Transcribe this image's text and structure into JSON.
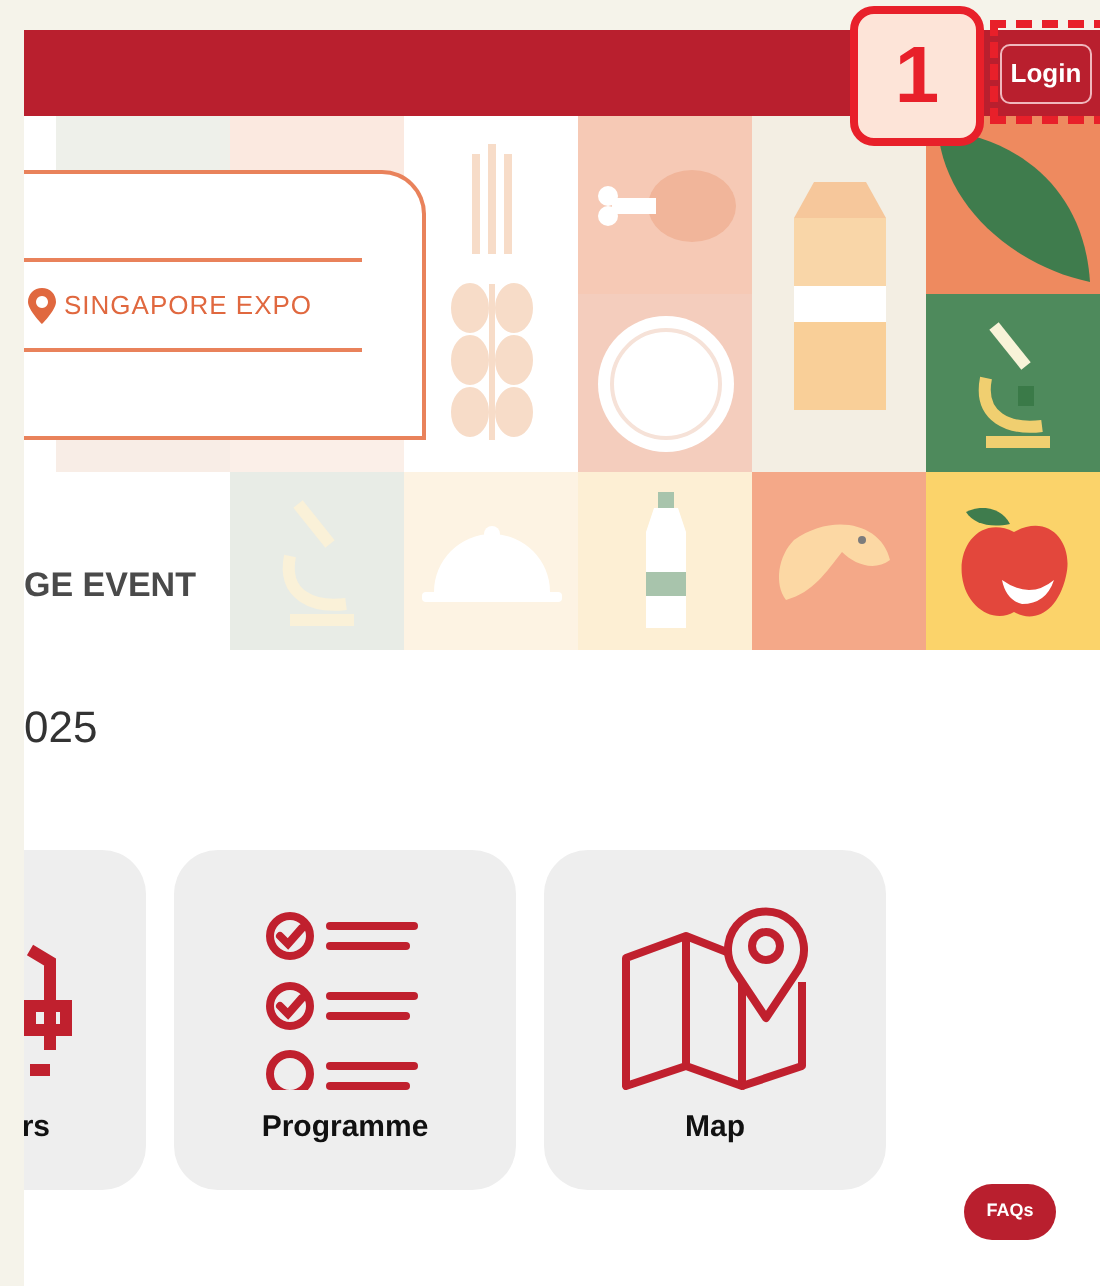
{
  "header": {
    "login_button": "Login"
  },
  "annotation": {
    "number": "1"
  },
  "banner": {
    "venue": "SINGAPORE EXPO",
    "tagline": "GE EVENT"
  },
  "title": "025",
  "tiles": [
    {
      "kind": "partial",
      "label": "rs"
    },
    {
      "kind": "programme",
      "label": "Programme"
    },
    {
      "kind": "map",
      "label": "Map"
    }
  ],
  "faq_button": "FAQs"
}
